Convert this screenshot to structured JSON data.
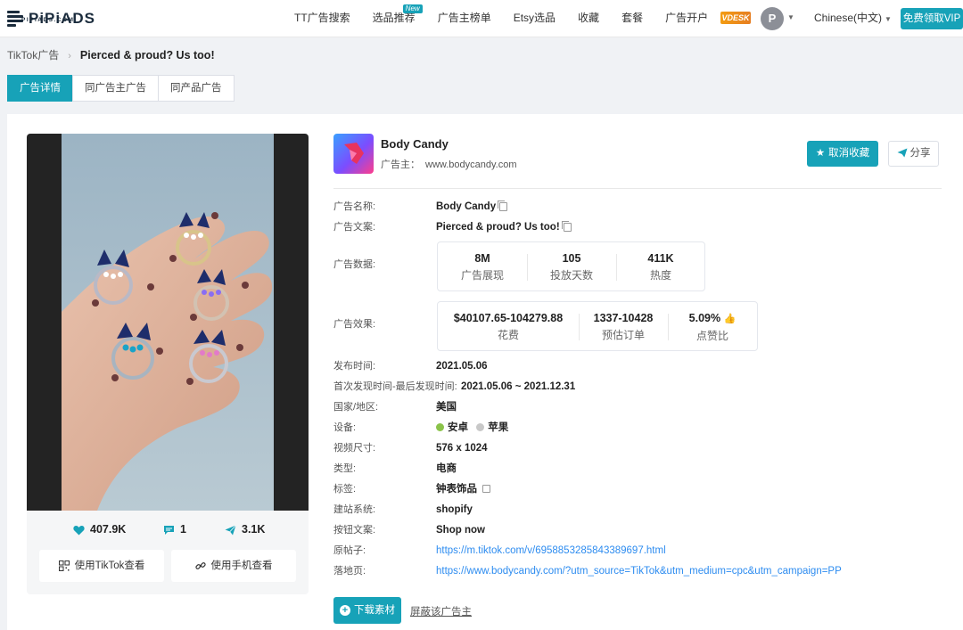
{
  "brand": {
    "logo_text": "PiPiADS",
    "logo_sub": "PIPIADS.COM"
  },
  "nav": {
    "items": [
      {
        "label": "TT广告搜索"
      },
      {
        "label": "选品推荐",
        "badge": "New"
      },
      {
        "label": "广告主榜单"
      },
      {
        "label": "Etsy选品"
      },
      {
        "label": "收藏"
      },
      {
        "label": "套餐"
      },
      {
        "label": "广告开户"
      }
    ],
    "vdesk_label": "VDESK",
    "avatar_letter": "P",
    "language": "Chinese(中文)",
    "vip_button": "免费领取VIP"
  },
  "breadcrumb": {
    "parent": "TikTok广告",
    "current": "Pierced & proud? Us too!"
  },
  "tabs": [
    {
      "label": "广告详情",
      "active": true
    },
    {
      "label": "同广告主广告",
      "active": false
    },
    {
      "label": "同产品广告",
      "active": false
    }
  ],
  "media": {
    "likes": "407.9K",
    "comments": "1",
    "shares": "3.1K",
    "view_tiktok": "使用TikTok查看",
    "view_phone": "使用手机查看"
  },
  "advertiser": {
    "name": "Body Candy",
    "label": "广告主：",
    "domain": "www.bodycandy.com",
    "fav_button": "取消收藏",
    "share_button": "分享"
  },
  "details": {
    "ad_name": {
      "label": "广告名称:",
      "value": "Body Candy"
    },
    "ad_copy": {
      "label": "广告文案:",
      "value": "Pierced & proud? Us too!"
    },
    "ad_data": {
      "label": "广告数据:",
      "metrics": [
        {
          "value": "8M",
          "key": "广告展现"
        },
        {
          "value": "105",
          "key": "投放天数"
        },
        {
          "value": "411K",
          "key": "热度"
        }
      ]
    },
    "ad_effect": {
      "label": "广告效果:",
      "metrics": [
        {
          "value": "$40107.65-104279.88",
          "key": "花费"
        },
        {
          "value": "1337-10428",
          "key": "预估订单"
        },
        {
          "value": "5.09%",
          "key": "点赞比"
        }
      ]
    },
    "publish_time": {
      "label": "发布时间:",
      "value": "2021.05.06"
    },
    "seen_range": {
      "label": "首次发现时间-最后发现时间:",
      "value": "2021.05.06 ~ 2021.12.31"
    },
    "country": {
      "label": "国家/地区:",
      "value": "美国"
    },
    "device": {
      "label": "设备:",
      "android": "安卓",
      "apple": "苹果",
      "android_color": "#8bc34a",
      "apple_color": "#c8c8c8"
    },
    "video_size": {
      "label": "视频尺寸:",
      "value": "576 x 1024"
    },
    "type": {
      "label": "类型:",
      "value": "电商"
    },
    "tags": {
      "label": "标签:",
      "value": "钟表饰品"
    },
    "site_system": {
      "label": "建站系统:",
      "value": "shopify"
    },
    "cta": {
      "label": "按钮文案:",
      "value": "Shop now"
    },
    "original_post": {
      "label": "原帖子:",
      "value": "https://m.tiktok.com/v/6958853285843389697.html"
    },
    "landing_page": {
      "label": "落地页:",
      "value": "https://www.bodycandy.com/?utm_source=TikTok&utm_medium=cpc&utm_campaign=PP"
    }
  },
  "actions": {
    "download": "下载素材",
    "block": "屏蔽该广告主"
  },
  "colors": {
    "accent": "#17a2b8",
    "link": "#2d8cf0",
    "like_ratio": "#f04e4e"
  },
  "icons": {
    "like": "heart-icon",
    "comment": "comment-icon",
    "share": "paper-plane-icon",
    "qr": "qr-code-icon",
    "phone_link": "link-icon",
    "fav": "star-icon",
    "download": "plus-circle-icon"
  }
}
